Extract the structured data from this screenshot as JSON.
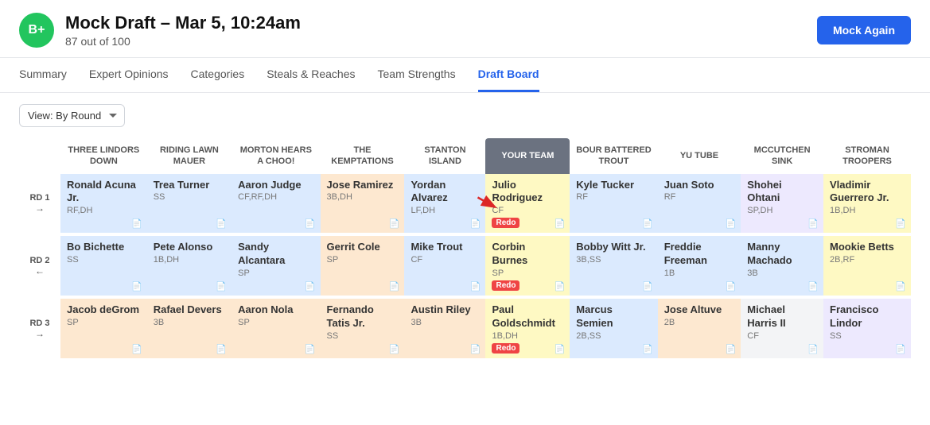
{
  "header": {
    "grade": "B+",
    "title": "Mock Draft – Mar 5, 10:24am",
    "score": "87 out of 100",
    "mock_again": "Mock Again"
  },
  "nav": {
    "items": [
      {
        "label": "Summary",
        "active": false
      },
      {
        "label": "Expert Opinions",
        "active": false
      },
      {
        "label": "Categories",
        "active": false
      },
      {
        "label": "Steals & Reaches",
        "active": false
      },
      {
        "label": "Team Strengths",
        "active": false
      },
      {
        "label": "Draft Board",
        "active": true
      }
    ]
  },
  "toolbar": {
    "view_label": "View: By Round"
  },
  "board": {
    "teams": [
      {
        "label": "THREE LINDORS DOWN"
      },
      {
        "label": "RIDING LAWN MAUER"
      },
      {
        "label": "MORTON HEARS A CHOO!"
      },
      {
        "label": "THE KEMPTATIONS"
      },
      {
        "label": "STANTON ISLAND"
      },
      {
        "label": "YOUR TEAM",
        "highlight": true
      },
      {
        "label": "BOUR BATTERED TROUT"
      },
      {
        "label": "YU TUBE"
      },
      {
        "label": "MCCUTCHEN SINK"
      },
      {
        "label": "STROMAN TROOPERS"
      }
    ],
    "rounds": [
      {
        "label": "RD 1",
        "arrow": "→",
        "picks": [
          {
            "name": "Ronald Acuna Jr.",
            "pos": "RF,DH",
            "bg": "blue"
          },
          {
            "name": "Trea Turner",
            "pos": "SS",
            "bg": "blue"
          },
          {
            "name": "Aaron Judge",
            "pos": "CF,RF,DH",
            "bg": "blue"
          },
          {
            "name": "Jose Ramirez",
            "pos": "3B,DH",
            "bg": "peach"
          },
          {
            "name": "Yordan Alvarez",
            "pos": "LF,DH",
            "bg": "blue"
          },
          {
            "name": "Julio Rodriguez",
            "pos": "CF",
            "bg": "yellow",
            "redo": true,
            "your_team": true
          },
          {
            "name": "Kyle Tucker",
            "pos": "RF",
            "bg": "blue"
          },
          {
            "name": "Juan Soto",
            "pos": "RF",
            "bg": "blue"
          },
          {
            "name": "Shohei Ohtani",
            "pos": "SP,DH",
            "bg": "purple"
          },
          {
            "name": "Vladimir Guerrero Jr.",
            "pos": "1B,DH",
            "bg": "yellow"
          }
        ]
      },
      {
        "label": "RD 2",
        "arrow": "←",
        "picks": [
          {
            "name": "Bo Bichette",
            "pos": "SS",
            "bg": "blue"
          },
          {
            "name": "Pete Alonso",
            "pos": "1B,DH",
            "bg": "blue"
          },
          {
            "name": "Sandy Alcantara",
            "pos": "SP",
            "bg": "blue"
          },
          {
            "name": "Gerrit Cole",
            "pos": "SP",
            "bg": "peach"
          },
          {
            "name": "Mike Trout",
            "pos": "CF",
            "bg": "blue"
          },
          {
            "name": "Corbin Burnes",
            "pos": "SP",
            "bg": "yellow",
            "redo": true,
            "your_team": true
          },
          {
            "name": "Bobby Witt Jr.",
            "pos": "3B,SS",
            "bg": "blue"
          },
          {
            "name": "Freddie Freeman",
            "pos": "1B",
            "bg": "blue"
          },
          {
            "name": "Manny Machado",
            "pos": "3B",
            "bg": "blue"
          },
          {
            "name": "Mookie Betts",
            "pos": "2B,RF",
            "bg": "yellow"
          }
        ]
      },
      {
        "label": "RD 3",
        "arrow": "→",
        "picks": [
          {
            "name": "Jacob deGrom",
            "pos": "SP",
            "bg": "peach"
          },
          {
            "name": "Rafael Devers",
            "pos": "3B",
            "bg": "peach"
          },
          {
            "name": "Aaron Nola",
            "pos": "SP",
            "bg": "peach"
          },
          {
            "name": "Fernando Tatis Jr.",
            "pos": "SS",
            "bg": "peach"
          },
          {
            "name": "Austin Riley",
            "pos": "3B",
            "bg": "peach"
          },
          {
            "name": "Paul Goldschmidt",
            "pos": "1B,DH",
            "bg": "yellow",
            "redo": true,
            "your_team": true
          },
          {
            "name": "Marcus Semien",
            "pos": "2B,SS",
            "bg": "blue"
          },
          {
            "name": "Jose Altuve",
            "pos": "2B",
            "bg": "peach"
          },
          {
            "name": "Michael Harris II",
            "pos": "CF",
            "bg": "gray"
          },
          {
            "name": "Francisco Lindor",
            "pos": "SS",
            "bg": "purple"
          }
        ]
      }
    ]
  }
}
